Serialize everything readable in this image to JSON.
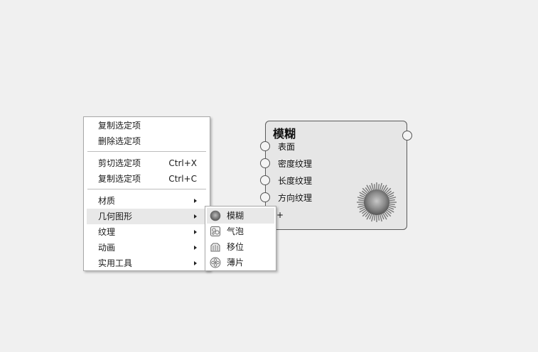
{
  "node": {
    "title": "模糊",
    "inputs": [
      "表面",
      "密度纹理",
      "长度纹理",
      "方向纹理"
    ],
    "add_port_label": "+"
  },
  "menu": {
    "items": [
      {
        "label": "复制选定项"
      },
      {
        "label": "删除选定项"
      },
      {
        "label": "剪切选定项",
        "shortcut": "Ctrl+X"
      },
      {
        "label": "复制选定项",
        "shortcut": "Ctrl+C"
      },
      {
        "label": "材质",
        "submenu": true
      },
      {
        "label": "几何图形",
        "submenu": true,
        "highlighted": true
      },
      {
        "label": "纹理",
        "submenu": true
      },
      {
        "label": "动画",
        "submenu": true
      },
      {
        "label": "实用工具",
        "submenu": true
      }
    ]
  },
  "submenu": {
    "items": [
      {
        "label": "模糊",
        "icon": "fur-icon",
        "highlighted": true
      },
      {
        "label": "气泡",
        "icon": "bubbles-icon"
      },
      {
        "label": "移位",
        "icon": "displacement-icon"
      },
      {
        "label": "薄片",
        "icon": "flakes-icon"
      }
    ]
  }
}
